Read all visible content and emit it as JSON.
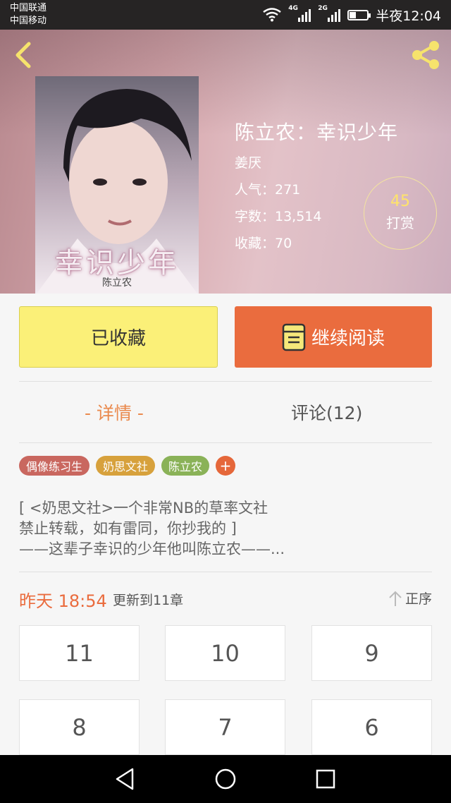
{
  "status": {
    "carrier1": "中国联通",
    "carrier2": "中国移动",
    "sig1_tag": "4G",
    "sig2_tag": "2G",
    "time": "半夜12:04"
  },
  "book": {
    "title": "陈立农：幸识少年",
    "author": "姜厌",
    "popularity": "人气：271",
    "words": "字数：13,514",
    "favorites": "收藏：70",
    "reward_count": "45",
    "reward_label": "打赏",
    "cover_title": "幸识少年",
    "cover_author": "陈立农"
  },
  "actions": {
    "collected_label": "已收藏",
    "read_label": "继续阅读"
  },
  "tabs": {
    "details": "- 详情 -",
    "comments": "评论(12)"
  },
  "tags": [
    {
      "label": "偶像练习生",
      "color": "#c9675f"
    },
    {
      "label": "奶思文社",
      "color": "#d7a13c"
    },
    {
      "label": "陈立农",
      "color": "#8ab258"
    }
  ],
  "tag_add": "+",
  "intro": {
    "line1": "[ <奶思文社>一个非常NB的草率文社",
    "line2": "禁止转载，如有雷同，你抄我的 ]",
    "line3": "——这辈子幸识的少年他叫陈立农——..."
  },
  "update": {
    "time": "昨天 18:54",
    "text": "更新到11章",
    "sort": "正序"
  },
  "chapters": [
    "11",
    "10",
    "9",
    "8",
    "7",
    "6"
  ],
  "colors": {
    "accent": "#ea6c3e",
    "collected_bg": "#fbf078",
    "tab_active": "#ea8a4e",
    "icon_yellow": "#f5e87a"
  }
}
